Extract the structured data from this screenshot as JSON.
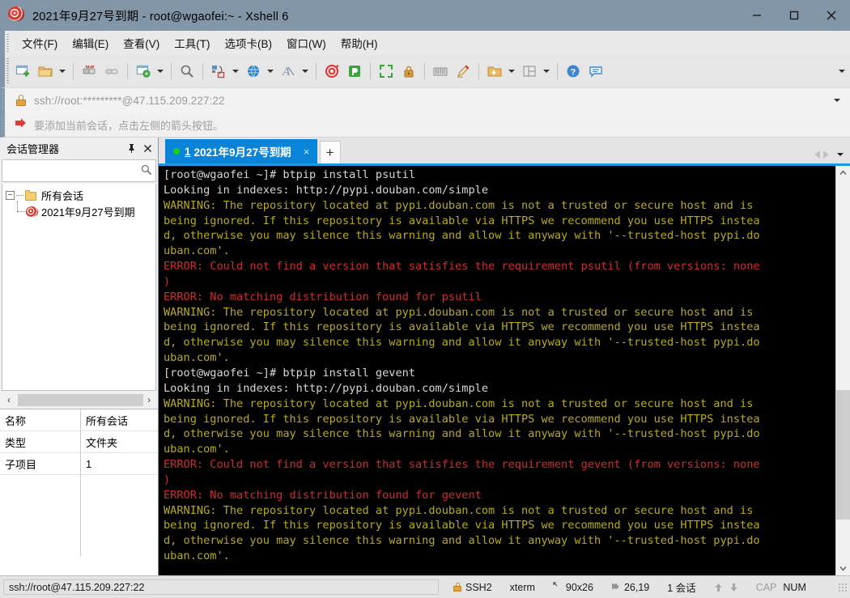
{
  "window": {
    "title": "2021年9月27号到期 - root@wgaofei:~ - Xshell 6",
    "minimize_label": "minimize",
    "maximize_label": "maximize",
    "close_label": "close"
  },
  "menu": {
    "items": [
      {
        "label": "文件(F)",
        "name": "menu-file"
      },
      {
        "label": "编辑(E)",
        "name": "menu-edit"
      },
      {
        "label": "查看(V)",
        "name": "menu-view"
      },
      {
        "label": "工具(T)",
        "name": "menu-tools"
      },
      {
        "label": "选项卡(B)",
        "name": "menu-tabs"
      },
      {
        "label": "窗口(W)",
        "name": "menu-window"
      },
      {
        "label": "帮助(H)",
        "name": "menu-help"
      }
    ]
  },
  "address_bar": {
    "value": "ssh://root:*********@47.115.209.227:22",
    "lock_icon": "lock-icon",
    "dropdown_icon": "chevron-down-icon"
  },
  "hint_bar": {
    "text": "要添加当前会话，点击左侧的箭头按钮。",
    "icon": "red-arrow-icon"
  },
  "sidebar": {
    "title": "会话管理器",
    "pin_icon": "pin-icon",
    "close_icon": "close-icon",
    "search": {
      "value": "",
      "placeholder": "",
      "icon": "search-icon"
    },
    "tree": {
      "root": {
        "label": "所有会话",
        "icon": "folder-icon",
        "expander": "−"
      },
      "children": [
        {
          "label": "2021年9月27号到期",
          "icon": "snail-icon"
        }
      ]
    },
    "hscroll": {
      "left_icon": "chevron-left-icon",
      "right_icon": "chevron-right-icon"
    },
    "properties": [
      {
        "key": "名称",
        "value": "所有会话"
      },
      {
        "key": "类型",
        "value": "文件夹"
      },
      {
        "key": "子项目",
        "value": "1"
      }
    ]
  },
  "tabs": {
    "items": [
      {
        "number": "1",
        "label": "2021年9月27号到期",
        "status": "connected",
        "close_icon": "close-icon"
      }
    ],
    "new_tab_label": "+",
    "nav_prev_icon": "triangle-left-icon",
    "nav_next_icon": "triangle-right-icon",
    "nav_menu_icon": "chevron-down-icon"
  },
  "terminal": {
    "lines": [
      {
        "text": "[root@wgaofei ~]# btpip install psutil",
        "color": "white"
      },
      {
        "text": "Looking in indexes: http://pypi.douban.com/simple",
        "color": "white"
      },
      {
        "text": "WARNING: The repository located at pypi.douban.com is not a trusted or secure host and is",
        "color": "warn"
      },
      {
        "text": "being ignored. If this repository is available via HTTPS we recommend you use HTTPS instea",
        "color": "warn"
      },
      {
        "text": "d, otherwise you may silence this warning and allow it anyway with '--trusted-host pypi.do",
        "color": "warn"
      },
      {
        "text": "uban.com'.",
        "color": "warn"
      },
      {
        "text": "ERROR: Could not find a version that satisfies the requirement psutil (from versions: none",
        "color": "err"
      },
      {
        "text": ")",
        "color": "err"
      },
      {
        "text": "ERROR: No matching distribution found for psutil",
        "color": "err"
      },
      {
        "text": "WARNING: The repository located at pypi.douban.com is not a trusted or secure host and is",
        "color": "warn"
      },
      {
        "text": "being ignored. If this repository is available via HTTPS we recommend you use HTTPS instea",
        "color": "warn"
      },
      {
        "text": "d, otherwise you may silence this warning and allow it anyway with '--trusted-host pypi.do",
        "color": "warn"
      },
      {
        "text": "uban.com'.",
        "color": "warn"
      },
      {
        "text": "[root@wgaofei ~]# btpip install gevent",
        "color": "white"
      },
      {
        "text": "Looking in indexes: http://pypi.douban.com/simple",
        "color": "white"
      },
      {
        "text": "WARNING: The repository located at pypi.douban.com is not a trusted or secure host and is",
        "color": "warn"
      },
      {
        "text": "being ignored. If this repository is available via HTTPS we recommend you use HTTPS instea",
        "color": "warn"
      },
      {
        "text": "d, otherwise you may silence this warning and allow it anyway with '--trusted-host pypi.do",
        "color": "warn"
      },
      {
        "text": "uban.com'.",
        "color": "warn"
      },
      {
        "text": "ERROR: Could not find a version that satisfies the requirement gevent (from versions: none",
        "color": "err"
      },
      {
        "text": ")",
        "color": "err"
      },
      {
        "text": "ERROR: No matching distribution found for gevent",
        "color": "err"
      },
      {
        "text": "WARNING: The repository located at pypi.douban.com is not a trusted or secure host and is",
        "color": "warn"
      },
      {
        "text": "being ignored. If this repository is available via HTTPS we recommend you use HTTPS instea",
        "color": "warn"
      },
      {
        "text": "d, otherwise you may silence this warning and allow it anyway with '--trusted-host pypi.do",
        "color": "warn"
      },
      {
        "text": "uban.com'.",
        "color": "warn"
      }
    ],
    "colors": {
      "background": "#000000",
      "white": "#d8d8d8",
      "warning": "#b9ac14",
      "error": "#d22b2b"
    },
    "scrollbar": {
      "up_icon": "chevron-up-icon",
      "down_icon": "chevron-down-icon"
    }
  },
  "status_bar": {
    "connection": "ssh://root@47.115.209.227:22",
    "protocol": "SSH2",
    "protocol_icon": "lock-icon",
    "term_type": "xterm",
    "size": "90x26",
    "size_icon": "resize-icon",
    "cursor": "26,19",
    "cursor_icon": "cursor-icon",
    "sessions": "1 会话",
    "upload_icon": "arrow-up-icon",
    "download_icon": "arrow-down-icon",
    "caps": "CAP",
    "num": "NUM"
  },
  "toolbar": {
    "buttons": [
      {
        "name": "new-session-icon",
        "label": "新建"
      },
      {
        "name": "open-folder-icon",
        "label": "打开"
      },
      {
        "name": "disconnect-icon",
        "label": "断开"
      },
      {
        "name": "reconnect-icon",
        "label": "重新连接"
      },
      {
        "name": "session-properties-icon",
        "label": "属性"
      },
      {
        "name": "find-icon",
        "label": "查找"
      },
      {
        "name": "transfer-icon",
        "label": "传输"
      },
      {
        "name": "globe-icon",
        "label": "浏览"
      },
      {
        "name": "font-icon",
        "label": "字体"
      },
      {
        "name": "snail-icon",
        "label": "Xshell"
      },
      {
        "name": "xftp-icon",
        "label": "Xftp"
      },
      {
        "name": "fullscreen-icon",
        "label": "全屏"
      },
      {
        "name": "lock-icon",
        "label": "锁定"
      },
      {
        "name": "keyboard-icon",
        "label": "键盘"
      },
      {
        "name": "highlight-icon",
        "label": "高亮"
      },
      {
        "name": "add-folder-icon",
        "label": "新建文件夹"
      },
      {
        "name": "layout-icon",
        "label": "排列"
      },
      {
        "name": "help-icon",
        "label": "帮助"
      },
      {
        "name": "chat-icon",
        "label": "反馈"
      }
    ],
    "overflow_icon": "chevron-down-icon"
  }
}
